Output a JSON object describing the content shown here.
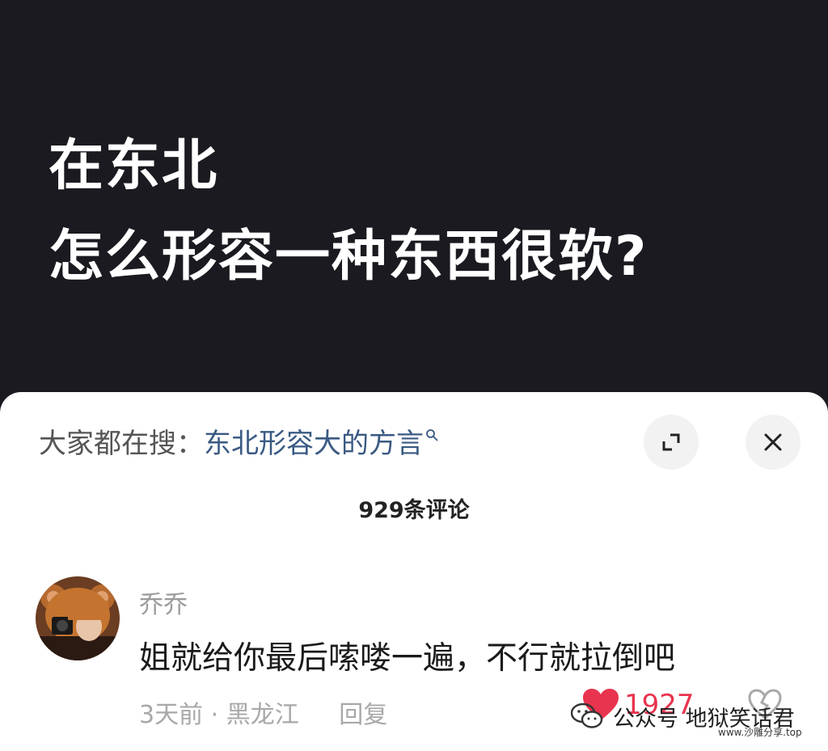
{
  "video": {
    "title_line1": "在东北",
    "title_line2": "怎么形容一种东西很软?"
  },
  "comments_sheet": {
    "search_prefix": "大家都在搜：",
    "search_query": "东北形容大的方言",
    "comment_count_label": "929条评论",
    "expand_icon": "expand-icon",
    "close_icon": "close-icon",
    "comments": [
      {
        "username": "乔乔",
        "text": "姐就给你最后嗦喽一遍，不行就拉倒吧",
        "time": "3天前",
        "separator": "·",
        "location": "黑龙江",
        "reply_label": "回复",
        "likes": "1927",
        "liked": true,
        "like_color": "#e8344e"
      }
    ]
  },
  "watermark": {
    "prefix": "公众号",
    "name": "地狱笑话君",
    "url": "www.沙雕分享.top"
  }
}
